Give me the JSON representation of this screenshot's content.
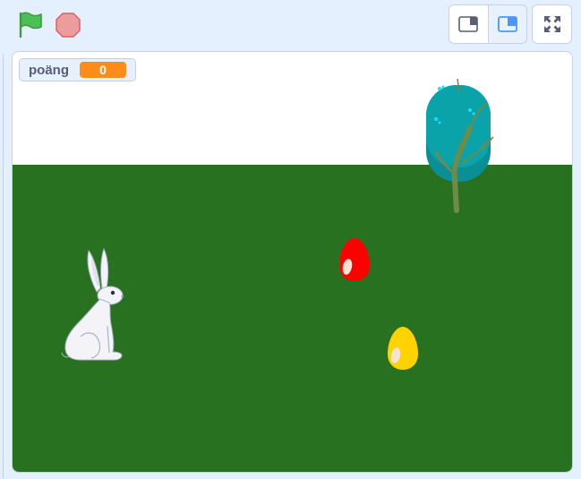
{
  "stage": {
    "sky_color": "#ffffff",
    "ground_color": "#287120"
  },
  "monitor": {
    "label": "poäng",
    "value": "0",
    "value_color": "#ff8c1a"
  },
  "controls": {
    "flag_icon": "green-flag-icon",
    "stop_icon": "stop-icon",
    "small_stage_icon": "small-stage-icon",
    "normal_stage_icon": "normal-stage-icon",
    "fullscreen_icon": "fullscreen-icon"
  },
  "sprites": [
    {
      "name": "rabbit",
      "color": "#f4f4f8"
    },
    {
      "name": "red-egg",
      "color": "#ff0000"
    },
    {
      "name": "yellow-egg",
      "color": "#ffd200"
    },
    {
      "name": "tree",
      "color": "#0aa1a8"
    }
  ]
}
